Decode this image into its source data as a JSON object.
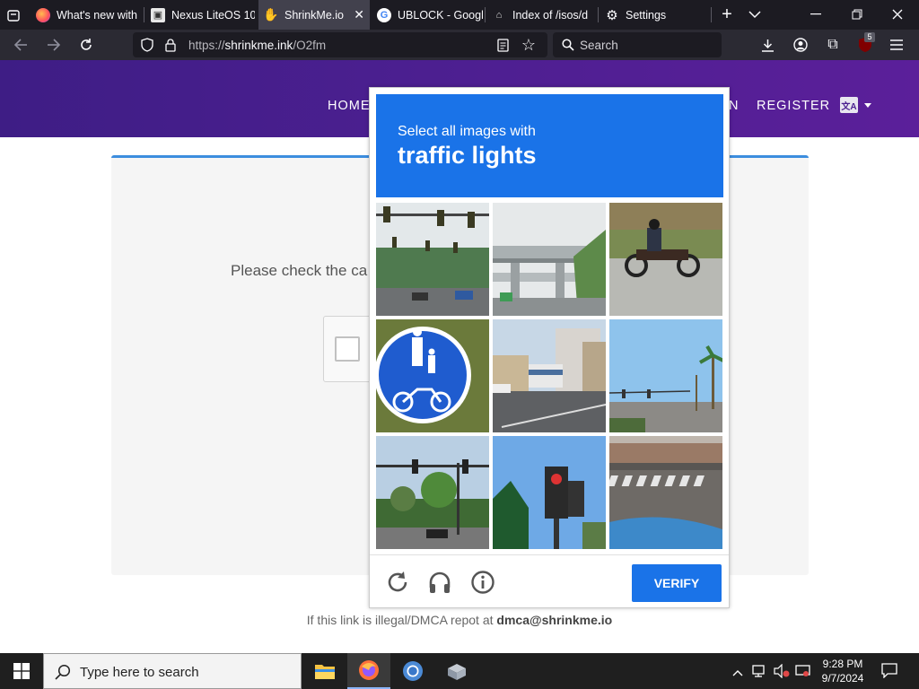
{
  "browser": {
    "tabs": [
      {
        "title": "What's new with"
      },
      {
        "title": "Nexus LiteOS 10"
      },
      {
        "title": "ShrinkMe.io"
      },
      {
        "title": "UBLOCK - Googl"
      },
      {
        "title": "Index of /isos/d"
      },
      {
        "title": "Settings"
      }
    ],
    "url_prefix": "https://",
    "url_host": "shrinkme.ink",
    "url_path": "/O2fm",
    "search_placeholder": "Search",
    "extension_badge": "5"
  },
  "site": {
    "nav": {
      "home": "HOME",
      "login": "N",
      "register": "REGISTER"
    },
    "lang_icon": "translate-icon",
    "check_message": "Please check the ca",
    "footer_prefix": "If this link is illegal/DMCA repot at",
    "footer_email": "dmca@shrinkme.io"
  },
  "captcha": {
    "instruction": "Select all images with",
    "target": "traffic lights",
    "verify_label": "VERIFY",
    "icons": [
      "refresh-icon",
      "headphones-icon",
      "info-icon"
    ],
    "tiles": [
      "traffic lights over road with trees",
      "elevated highway overpass",
      "motorcyclist on road",
      "blue pedestrian and bicycle sign",
      "city street with bus",
      "road with palm trees and traffic light",
      "intersection with traffic signals",
      "pedestrian traffic light",
      "crosswalk on street"
    ],
    "colors": {
      "header": "#1a73e8",
      "button": "#1a73e8"
    }
  },
  "taskbar": {
    "search_placeholder": "Type here to search",
    "time": "9:28 PM",
    "date": "9/7/2024"
  }
}
